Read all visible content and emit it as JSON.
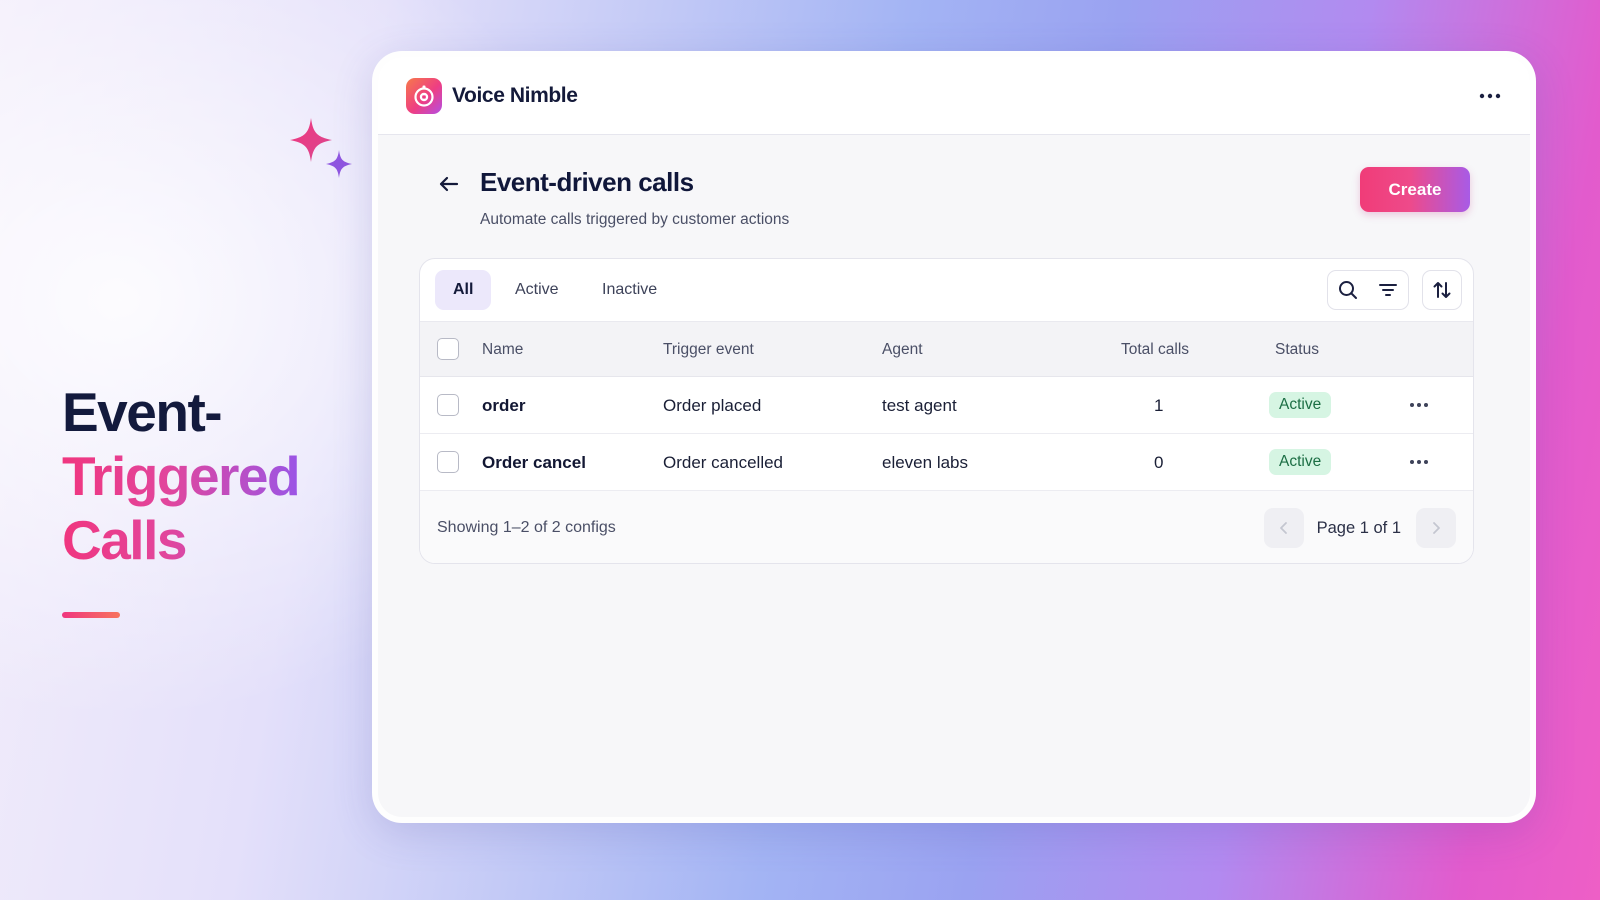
{
  "hero": {
    "line1": "Event-",
    "line2": "Triggered",
    "line3": "Calls"
  },
  "app": {
    "name": "Voice Nimble",
    "logo_icon": "voice-bot-icon",
    "menu_icon": "more-horizontal-icon"
  },
  "page": {
    "title": "Event-driven calls",
    "subtitle": "Automate calls triggered by customer actions",
    "back_icon": "arrow-left-icon",
    "create_label": "Create"
  },
  "tabs": [
    {
      "label": "All",
      "selected": true
    },
    {
      "label": "Active",
      "selected": false
    },
    {
      "label": "Inactive",
      "selected": false
    }
  ],
  "tools": [
    "search-icon",
    "filter-icon",
    "sort-icon"
  ],
  "table": {
    "columns": [
      "Name",
      "Trigger event",
      "Agent",
      "Total calls",
      "Status"
    ],
    "rows": [
      {
        "name": "order",
        "trigger": "Order placed",
        "agent": "test agent",
        "total_calls": "1",
        "status": "Active"
      },
      {
        "name": "Order cancel",
        "trigger": "Order cancelled",
        "agent": "eleven labs",
        "total_calls": "0",
        "status": "Active"
      }
    ]
  },
  "footer": {
    "showing": "Showing 1–2 of 2 configs",
    "page_label": "Page 1 of 1"
  },
  "colors": {
    "accent_pink": "#f03c78",
    "accent_purple": "#a85be6",
    "active_badge_bg": "#d6f5e3",
    "active_badge_text": "#1c6e44",
    "selected_tab_bg": "#ece8fb"
  }
}
